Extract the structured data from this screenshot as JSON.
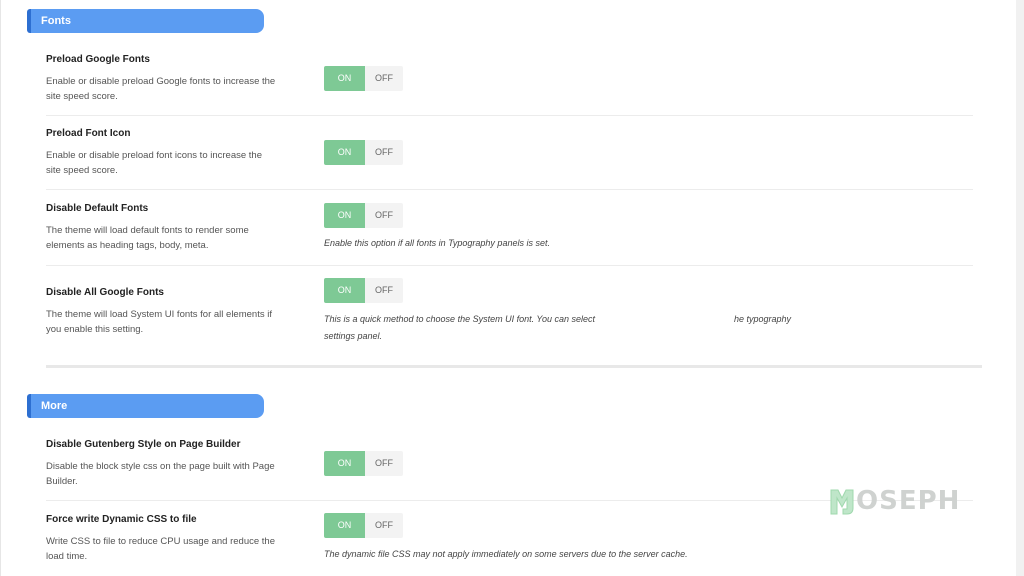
{
  "sections": {
    "fonts": {
      "label": "Fonts",
      "rows": [
        {
          "title": "Preload Google Fonts",
          "desc": "Enable or disable preload Google fonts to increase the site speed score.",
          "on": "ON",
          "off": "OFF",
          "state": "on"
        },
        {
          "title": "Preload Font Icon",
          "desc": "Enable or disable preload font icons to increase the site speed score.",
          "on": "ON",
          "off": "OFF",
          "state": "on"
        },
        {
          "title": "Disable Default Fonts",
          "desc": "The theme will load default fonts to render some elements as heading tags, body, meta.",
          "on": "ON",
          "off": "OFF",
          "state": "on",
          "note": "Enable this option if all fonts in Typography panels is set."
        },
        {
          "title": "Disable All Google Fonts",
          "desc": "The theme will load System UI fonts for all elements if you enable this setting.",
          "on": "ON",
          "off": "OFF",
          "state": "on",
          "note_line1_a": "This is a quick method to choose the System UI font. You can select",
          "note_line1_b": "he typography",
          "note_line2": "settings panel."
        }
      ]
    },
    "more": {
      "label": "More",
      "rows": [
        {
          "title": "Disable Gutenberg Style on Page Builder",
          "desc": "Disable the block style css on the page built with Page Builder.",
          "on": "ON",
          "off": "OFF",
          "state": "on"
        },
        {
          "title": "Force write Dynamic CSS to file",
          "desc": "Write CSS to file to reduce CPU usage and reduce the load time.",
          "on": "ON",
          "off": "OFF",
          "state": "on",
          "note": "The dynamic file CSS may not apply immediately on some servers due to the server cache."
        }
      ]
    }
  },
  "watermark": {
    "text": "OSEPH",
    "logo_icon": "mj-logo-icon"
  },
  "colors": {
    "header": "#5b9cf2",
    "toggle_on": "#7ec995",
    "toggle_off": "#f3f3f3"
  }
}
